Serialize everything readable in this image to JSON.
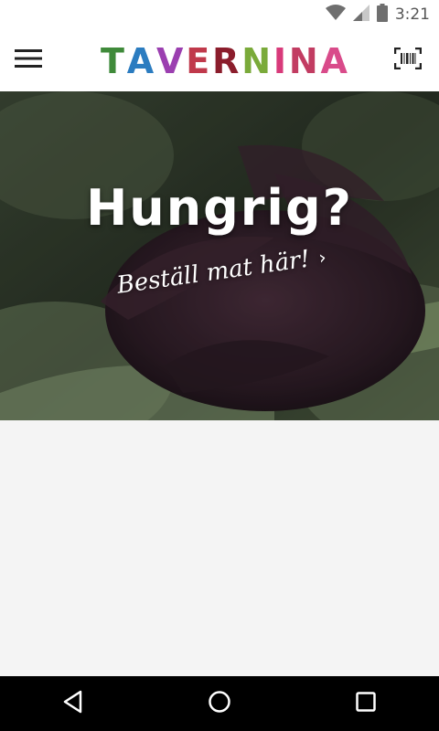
{
  "status_bar": {
    "time": "3:21",
    "icons": [
      "wifi-icon",
      "signal-icon",
      "battery-icon"
    ]
  },
  "app_bar": {
    "logo_letters": [
      {
        "char": "T",
        "color": "#3f8a3a"
      },
      {
        "char": "A",
        "color": "#2b7cc0"
      },
      {
        "char": "V",
        "color": "#9b3fb0"
      },
      {
        "char": "E",
        "color": "#c0394b"
      },
      {
        "char": "R",
        "color": "#8b1d2c"
      },
      {
        "char": "N",
        "color": "#7aaa3a"
      },
      {
        "char": "I",
        "color": "#d83a7a"
      },
      {
        "char": "N",
        "color": "#c23c62"
      },
      {
        "char": "A",
        "color": "#d94b8a"
      }
    ],
    "menu_icon": "hamburger-menu-icon",
    "scan_icon": "barcode-scan-icon"
  },
  "hero": {
    "title": "Hungrig?",
    "cta": "Beställ mat här!",
    "cta_chevron": "›"
  },
  "nav_bar": {
    "icons": [
      "back-icon",
      "home-icon",
      "recents-icon"
    ]
  },
  "colors": {
    "appbar_bg": "#ffffff",
    "content_bg": "#f4f4f4",
    "navbar_bg": "#000000"
  }
}
